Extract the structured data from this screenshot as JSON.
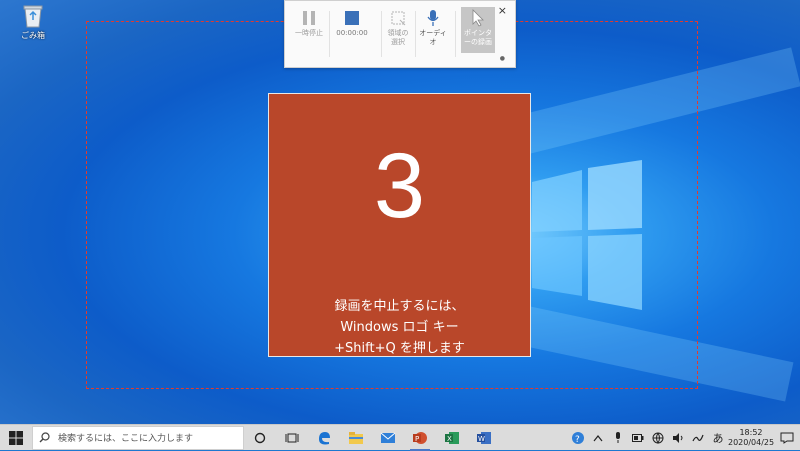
{
  "desktop": {
    "recycle_bin_label": "ごみ箱"
  },
  "recorder_toolbar": {
    "pause_label": "一時停止",
    "timer": "00:00:00",
    "select_area_label": "領域の選択",
    "audio_label": "オーディオ",
    "pointer_label": "ポインターの録画",
    "close_symbol": "×"
  },
  "countdown": {
    "number": "3",
    "line1": "録画を中止するには、",
    "line2": "Windows ロゴ キー",
    "line3": "+Shift+Q を押します"
  },
  "taskbar": {
    "search_placeholder": "検索するには、ここに入力します",
    "ime_label": "あ",
    "time": "18:52",
    "date": "2020/04/25"
  },
  "colors": {
    "countdown_bg": "#b9472a",
    "region_border": "#e23a2e",
    "desktop_blue": "#1678e0"
  }
}
